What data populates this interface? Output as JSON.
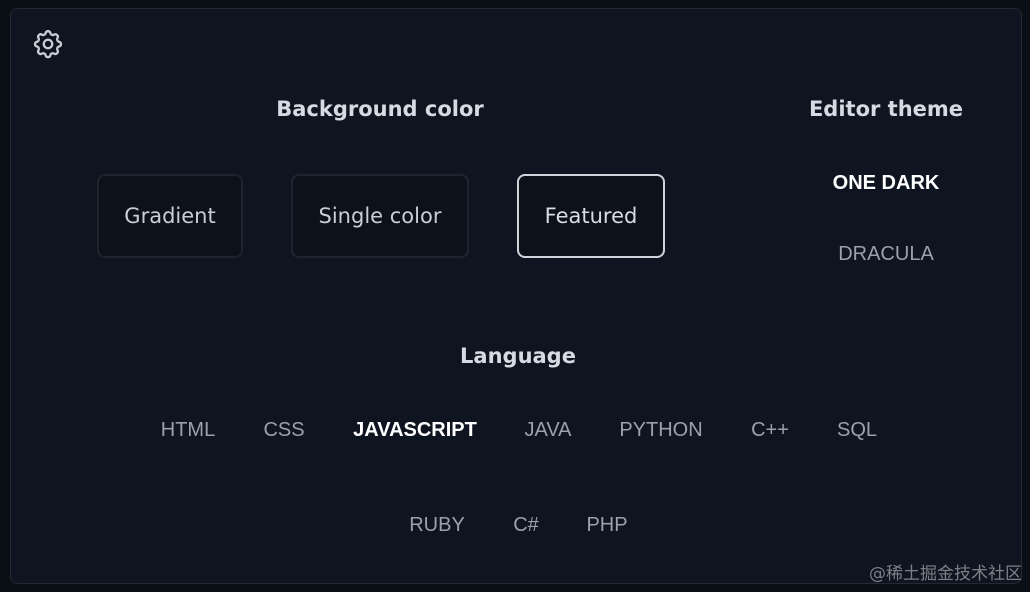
{
  "settings": {
    "icon": "gear-icon"
  },
  "background": {
    "heading": "Background color",
    "options": [
      {
        "label": "Gradient",
        "selected": false
      },
      {
        "label": "Single color",
        "selected": false
      },
      {
        "label": "Featured",
        "selected": true
      }
    ]
  },
  "theme": {
    "heading": "Editor theme",
    "options": [
      {
        "label": "ONE DARK",
        "selected": true
      },
      {
        "label": "DRACULA",
        "selected": false
      }
    ]
  },
  "language": {
    "heading": "Language",
    "options": [
      {
        "label": "HTML",
        "selected": false
      },
      {
        "label": "CSS",
        "selected": false
      },
      {
        "label": "JAVASCRIPT",
        "selected": true
      },
      {
        "label": "JAVA",
        "selected": false
      },
      {
        "label": "PYTHON",
        "selected": false
      },
      {
        "label": "C++",
        "selected": false
      },
      {
        "label": "SQL",
        "selected": false
      },
      {
        "label": "RUBY",
        "selected": false
      },
      {
        "label": "C#",
        "selected": false
      },
      {
        "label": "PHP",
        "selected": false
      }
    ]
  },
  "watermark": "@稀土掘金技术社区",
  "colors": {
    "page_bg": "#0b0f16",
    "panel_bg": "#0f1520",
    "selected_text": "#ffffff",
    "muted_text": "#9aa1ab",
    "selected_border": "#cfd3da"
  }
}
